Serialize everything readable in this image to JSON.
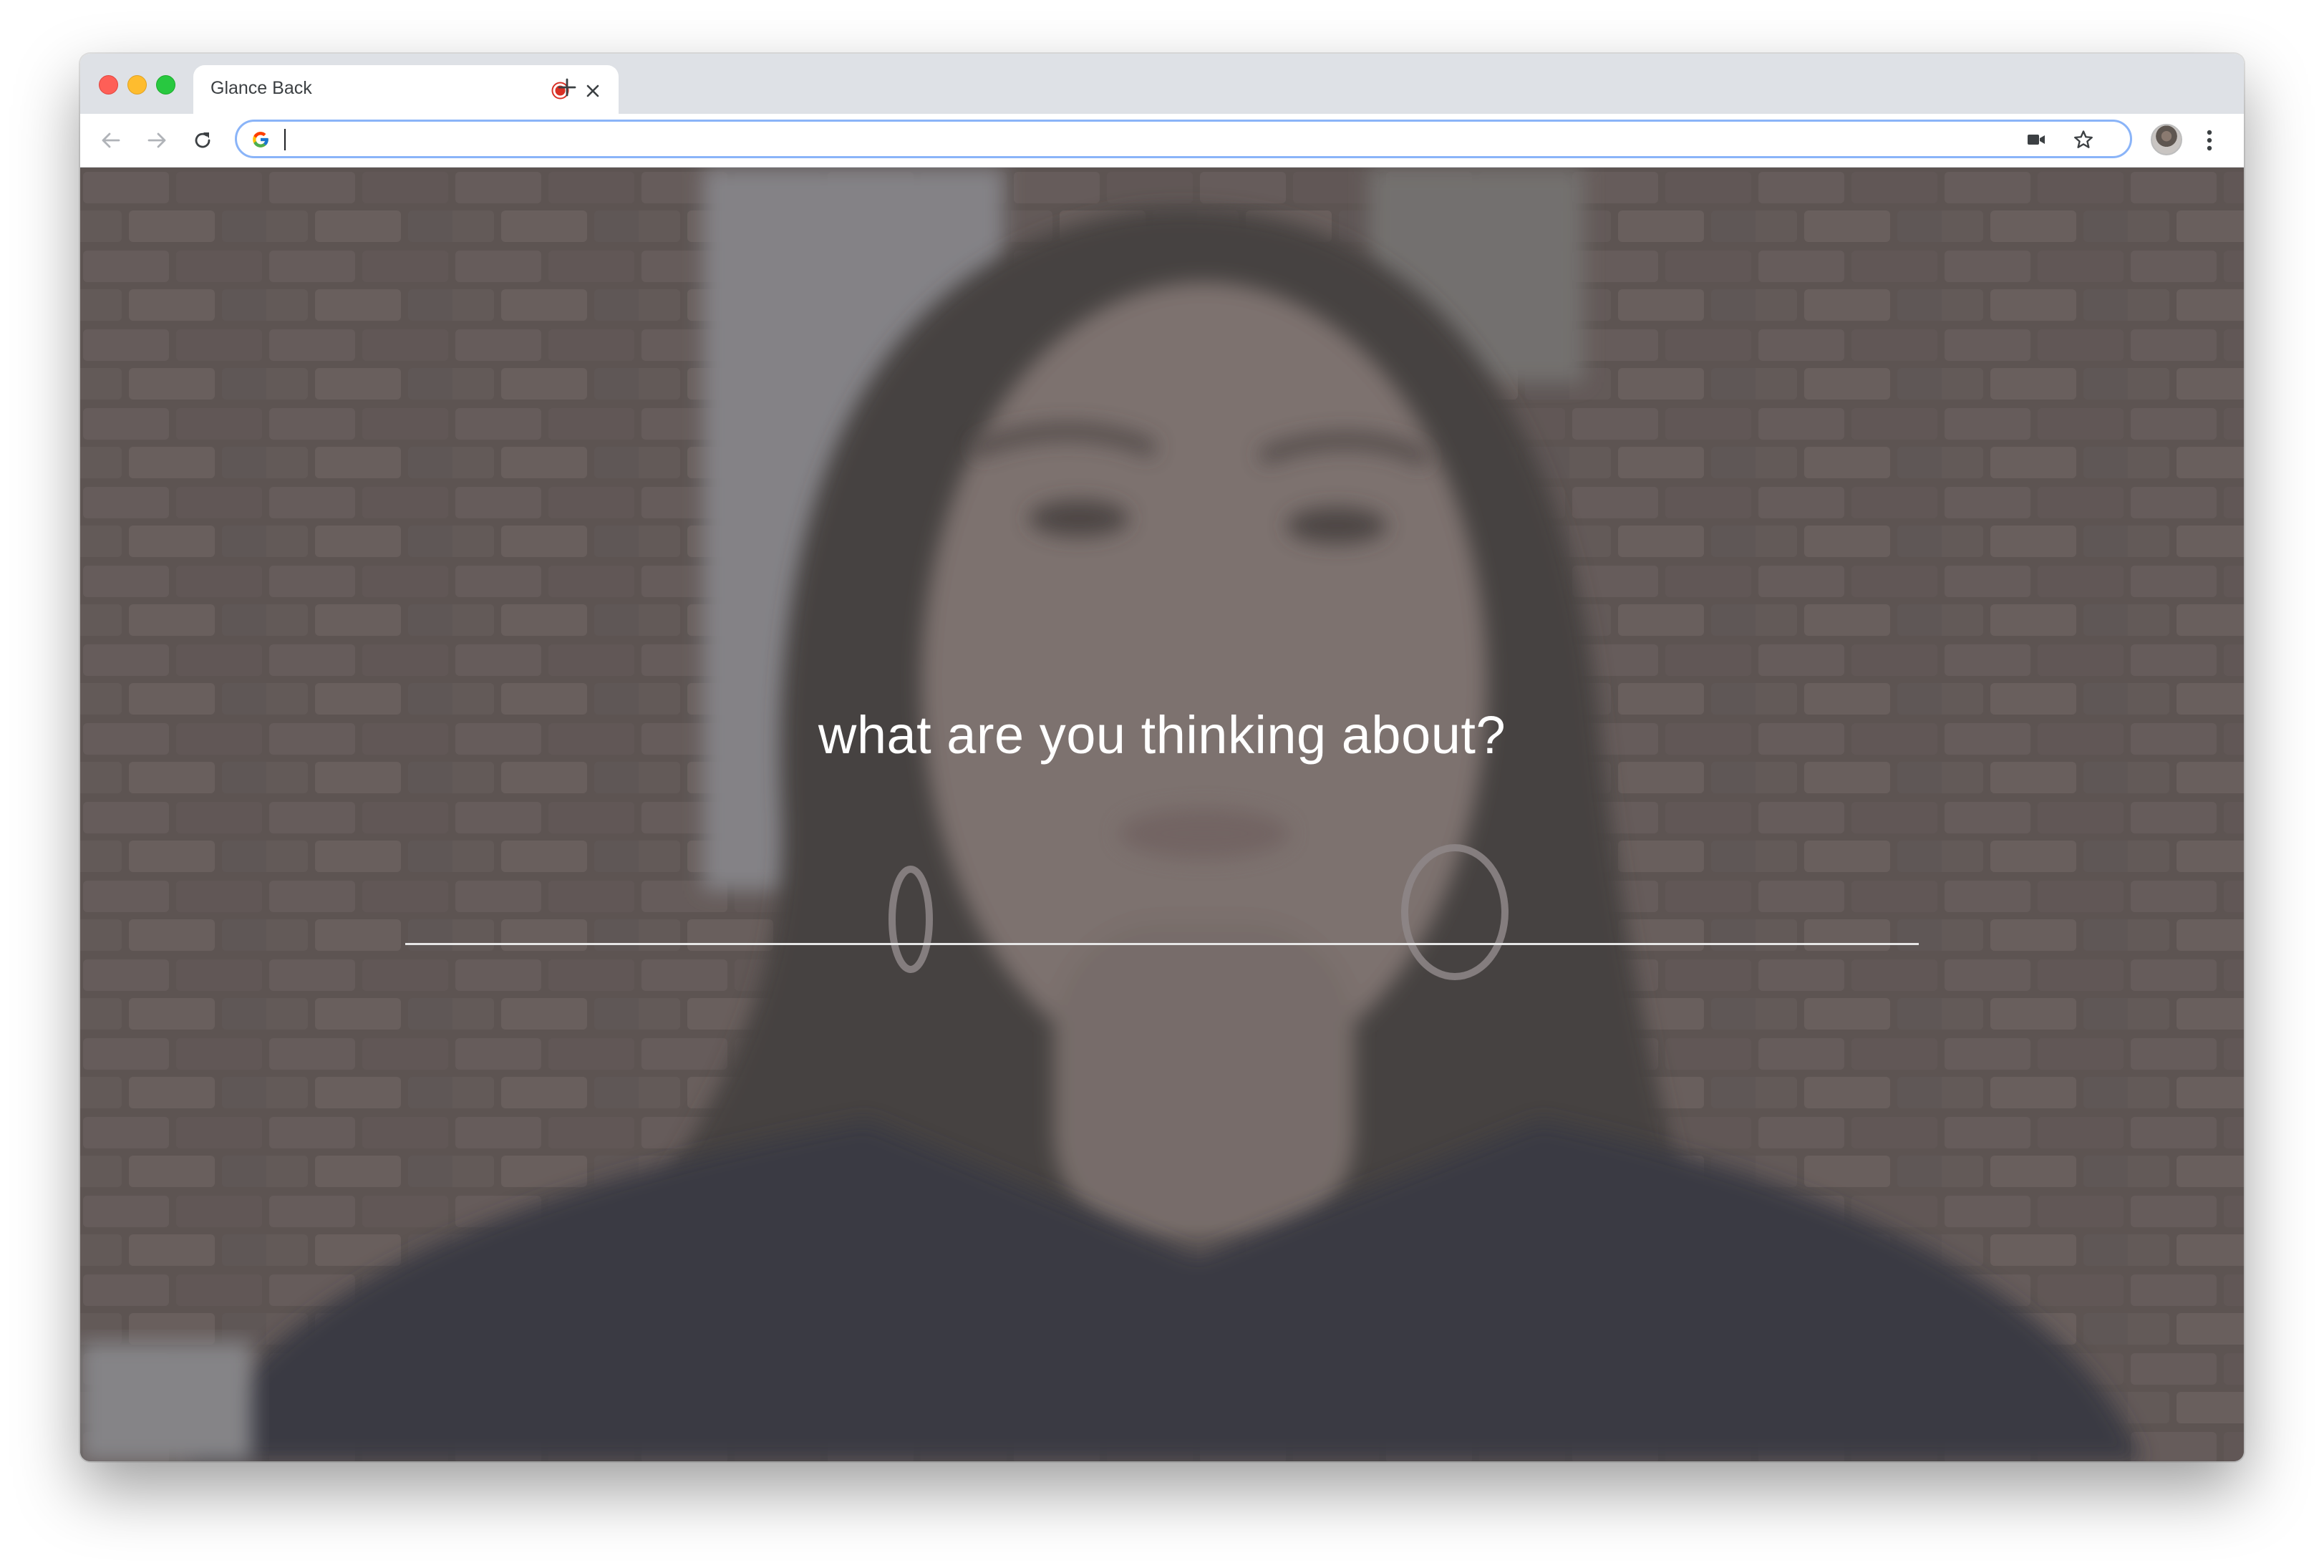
{
  "browser": {
    "tab": {
      "title": "Glance Back",
      "recording_indicator": "record-icon",
      "close_icon": "close-icon"
    },
    "new_tab_icon": "plus-icon",
    "toolbar": {
      "back_icon": "arrow-left-icon",
      "forward_icon": "arrow-right-icon",
      "reload_icon": "reload-icon",
      "omnibox": {
        "value": "",
        "placeholder": "",
        "search_engine_icon": "google-g-icon",
        "camera_indicator_icon": "camera-icon",
        "bookmark_icon": "star-icon"
      },
      "profile_icon": "avatar",
      "menu_icon": "kebab-menu-icon"
    },
    "colors": {
      "tabstrip": "#dee1e6",
      "omnibox_focus": "#8ab4f8",
      "traffic_red": "#fe5f57",
      "traffic_yellow": "#febc2e",
      "traffic_green": "#28c840",
      "recording_red": "#d93025"
    }
  },
  "page": {
    "prompt": "what are you thinking about?",
    "answer_input": {
      "value": "",
      "placeholder": ""
    },
    "background": "webcam-view"
  }
}
